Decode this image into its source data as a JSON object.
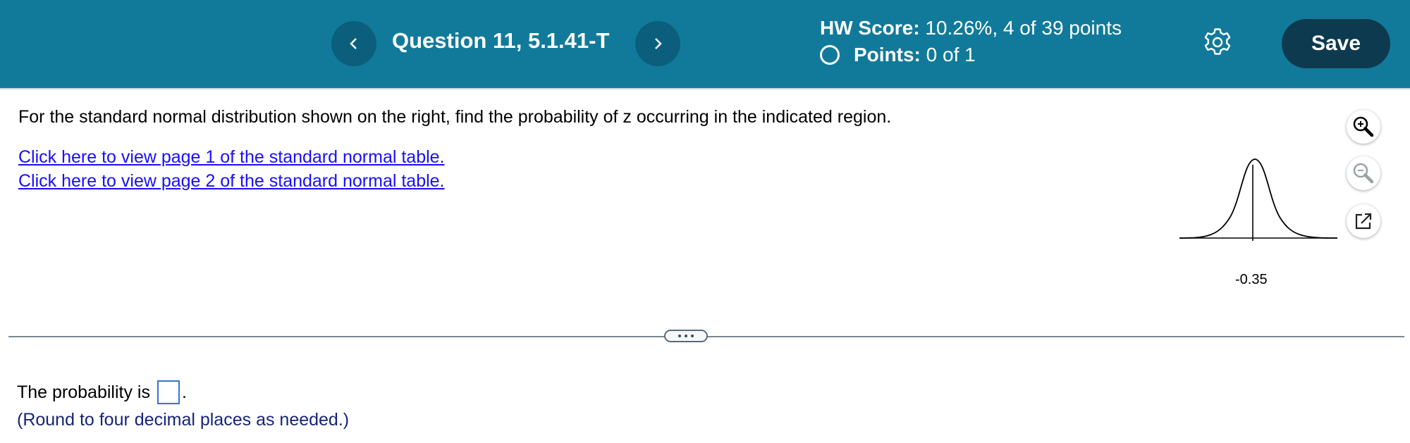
{
  "header": {
    "question_title": "Question 11, 5.1.41-T",
    "hw_score_label": "HW Score:",
    "hw_score_value": "10.26%, 4 of 39 points",
    "points_label": "Points:",
    "points_value": "0 of 1",
    "save_label": "Save",
    "bar_color": "#117a9a",
    "save_color": "#0d3a4f"
  },
  "question": {
    "text": "For the standard normal distribution shown on the right, find the probability of z occurring in the indicated region.",
    "link1": "Click here to view page 1 of the standard normal table.",
    "link2": "Click here to view page 2 of the standard normal table."
  },
  "figure": {
    "z_value": -0.35,
    "z_label": "-0.35"
  },
  "tools": {
    "zoom_in": "zoom-in-icon",
    "zoom_out": "zoom-out-icon",
    "popout": "popout-icon"
  },
  "answer": {
    "prefix": "The probability is",
    "suffix": ".",
    "value": "",
    "hint": "(Round to four decimal places as needed.)"
  }
}
